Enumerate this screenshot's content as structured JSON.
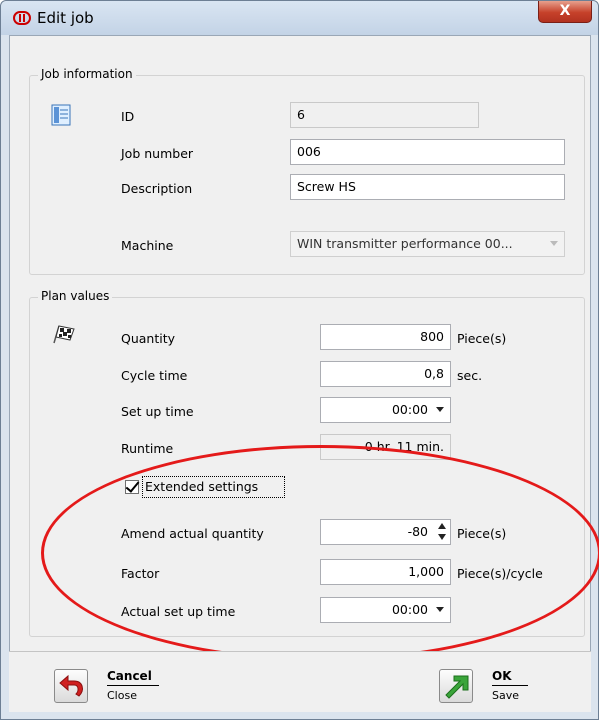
{
  "window": {
    "title": "Edit job",
    "close_label": "X"
  },
  "job_info": {
    "group_title": "Job information",
    "id_label": "ID",
    "id_value": "6",
    "job_number_label": "Job number",
    "job_number_value": "006",
    "description_label": "Description",
    "description_value": "Screw HS",
    "machine_label": "Machine",
    "machine_value": "WIN transmitter performance 00..."
  },
  "plan": {
    "group_title": "Plan values",
    "quantity_label": "Quantity",
    "quantity_value": "800",
    "quantity_unit": "Piece(s)",
    "cycle_label": "Cycle time",
    "cycle_value": "0,8",
    "cycle_unit": "sec.",
    "setup_label": "Set up time",
    "setup_value": "00:00",
    "runtime_label": "Runtime",
    "runtime_value": "0 hr. 11 min.",
    "extended_label": "Extended settings",
    "amend_label": "Amend actual quantity",
    "amend_value": "-80",
    "amend_unit": "Piece(s)",
    "factor_label": "Factor",
    "factor_value": "1,000",
    "factor_unit": "Piece(s)/cycle",
    "actual_setup_label": "Actual set up time",
    "actual_setup_value": "00:00"
  },
  "footer": {
    "cancel_label": "Cancel",
    "cancel_sub": "Close",
    "ok_label": "OK",
    "ok_sub": "Save"
  },
  "colors": {
    "annotation_ellipse": "#e41a1a",
    "ok_icon": "#3aa53a",
    "cancel_icon": "#d02020"
  }
}
